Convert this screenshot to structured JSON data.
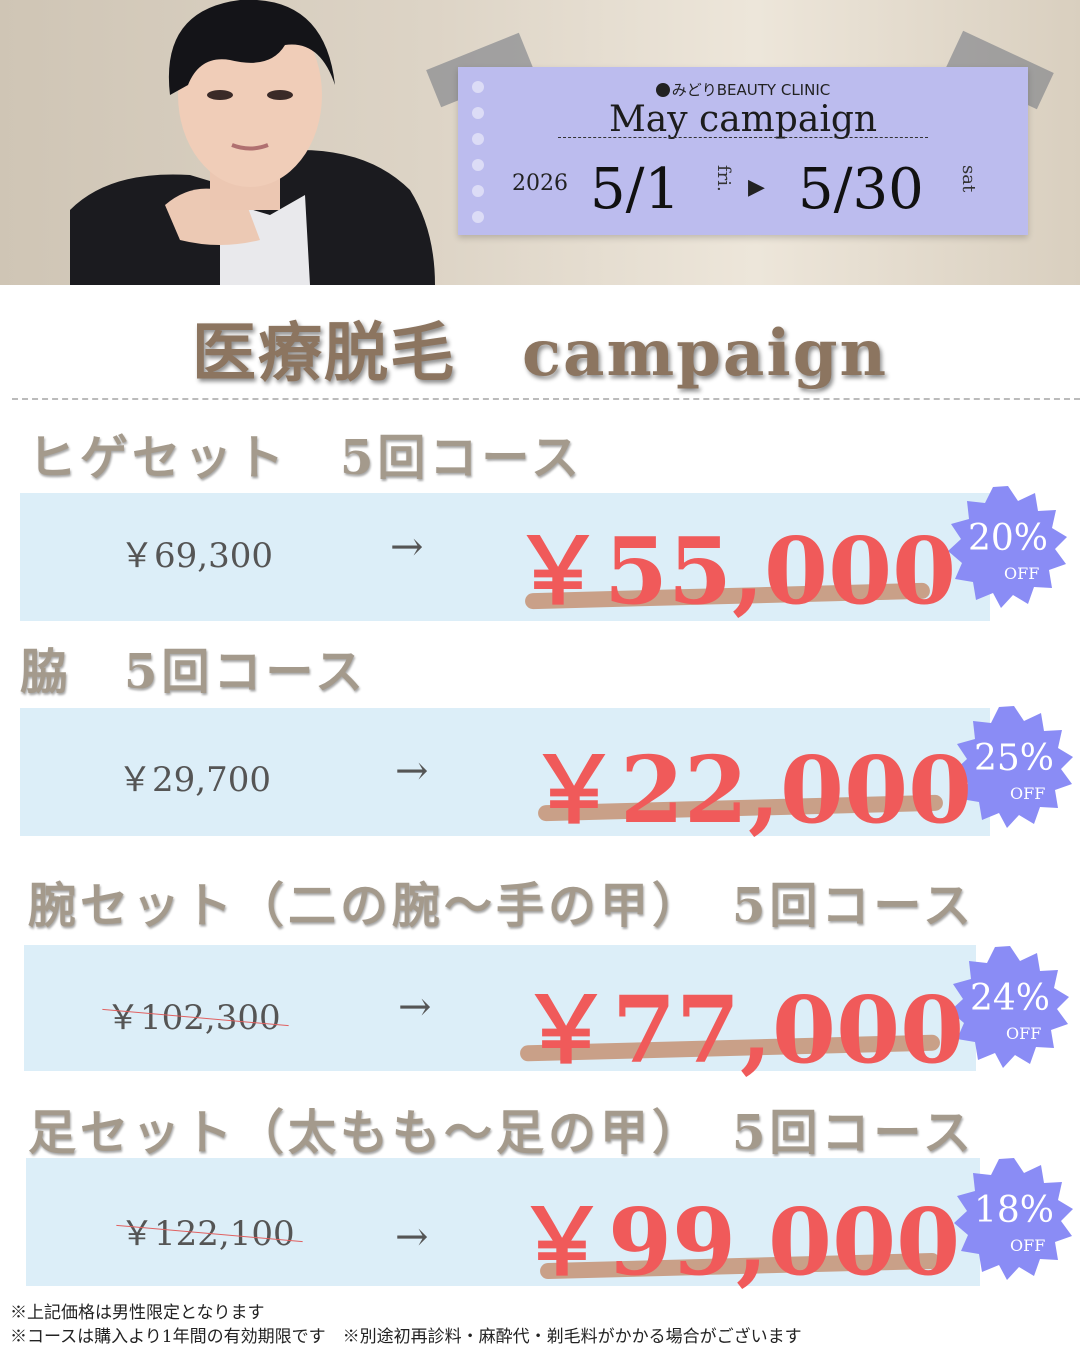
{
  "header": {
    "brand": "みどりBEAUTY CLINIC",
    "campaign": "May campaign",
    "year": "2026",
    "start_date": "5/1",
    "start_day": "fri.",
    "end_date": "5/30",
    "end_day": "sat"
  },
  "title": "医療脱毛　campaign",
  "courses": [
    {
      "label": "ヒゲセット　5回コース",
      "old_price": "￥69,300",
      "arrow": "→",
      "new_price": "￥55,000",
      "discount": "20%",
      "off": "OFF"
    },
    {
      "label": "脇　5回コース",
      "old_price": "￥29,700",
      "arrow": "→",
      "new_price": "￥22,000",
      "discount": "25%",
      "off": "OFF"
    },
    {
      "label": "腕セット（二の腕～手の甲）　5回コース",
      "old_price": "￥102,300",
      "arrow": "→",
      "new_price": "￥77,000",
      "discount": "24%",
      "off": "OFF"
    },
    {
      "label": "足セット（太もも～足の甲）　5回コース",
      "old_price": "￥122,100",
      "arrow": "→",
      "new_price": "￥99,000",
      "discount": "18%",
      "off": "OFF"
    }
  ],
  "notes": [
    "※上記価格は男性限定となります",
    "※コースは購入より1年間の有効期限です　※別途初再診料・麻酔代・剃毛料がかかる場合がございます"
  ],
  "colors": {
    "ticket": "#bcbcee",
    "badge": "#8a8cf5",
    "price": "#f05a5a",
    "row": "#dceef8"
  }
}
